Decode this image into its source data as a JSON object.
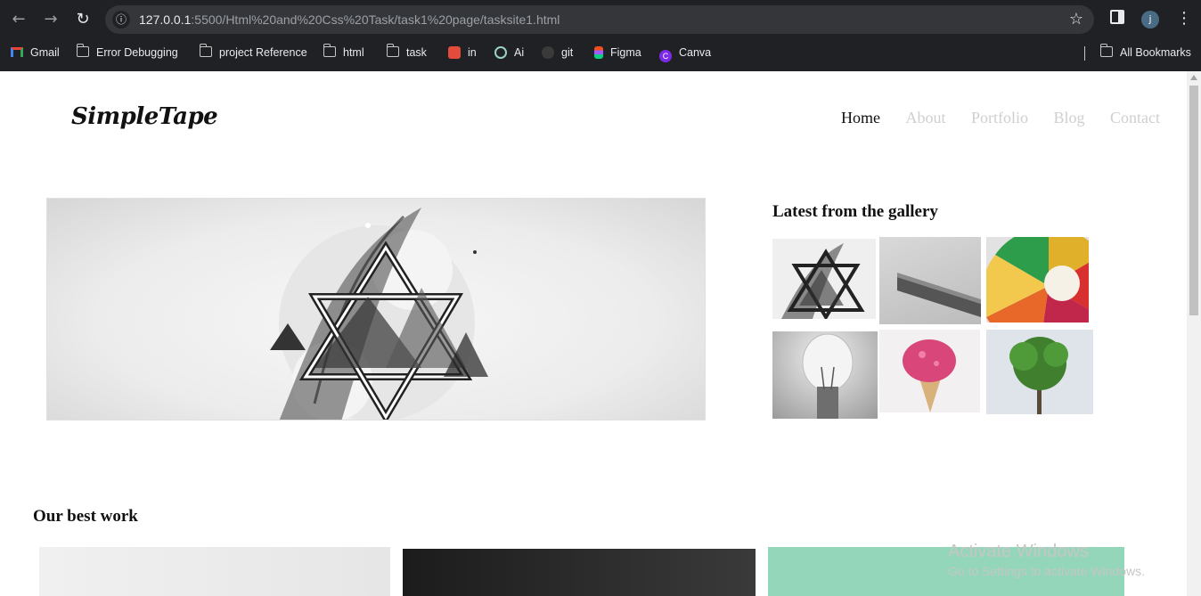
{
  "browser": {
    "url_host": "127.0.0.1",
    "url_path": ":5500/Html%20and%20Css%20Task/task1%20page/tasksite1.html",
    "profile_initial": "j",
    "bookmarks": [
      {
        "label": "Gmail",
        "icon": "gmail-icon"
      },
      {
        "label": "Error Debugging",
        "icon": "folder-icon"
      },
      {
        "label": "project Reference",
        "icon": "folder-icon"
      },
      {
        "label": "html",
        "icon": "folder-icon"
      },
      {
        "label": "task",
        "icon": "folder-icon"
      },
      {
        "label": "in",
        "icon": "app-grid-icon"
      },
      {
        "label": "Ai",
        "icon": "chatgpt-icon"
      },
      {
        "label": "git",
        "icon": "github-icon"
      },
      {
        "label": "Figma",
        "icon": "figma-icon"
      },
      {
        "label": "Canva",
        "icon": "canva-icon"
      }
    ],
    "all_bookmarks": "All Bookmarks"
  },
  "site": {
    "logo": "SimpleTape",
    "nav": [
      "Home",
      "About",
      "Portfolio",
      "Blog",
      "Contact"
    ],
    "active_nav": "Home",
    "gallery_title": "Latest from the gallery",
    "gallery_thumbs": [
      "wings-triangle",
      "minim-text",
      "color-wheel",
      "light-bulb",
      "ice-cream",
      "tree"
    ],
    "best_work_title": "Our best work"
  },
  "os_watermark": {
    "title": "Activate Windows",
    "subtitle": "Go to Settings to activate Windows."
  },
  "colors": {
    "chrome_bg": "#202124",
    "omnibox_bg": "#35363a",
    "nav_inactive": "#cfcfcf",
    "nav_active": "#111111"
  }
}
